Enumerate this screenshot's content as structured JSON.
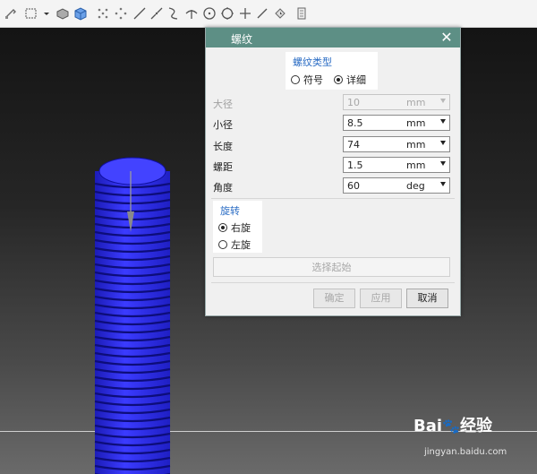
{
  "toolbar": {
    "icons": [
      "wrench-icon",
      "select-box-icon",
      "dropdown-arrow-icon",
      "solid-icon",
      "cube-icon",
      "snap-icon",
      "points-icon",
      "line-icon",
      "curve-icon",
      "spline-icon",
      "normal-icon",
      "circle-icon",
      "gear-point-icon",
      "cross-icon",
      "diagonal-icon",
      "cursor-icon",
      "panel-icon"
    ]
  },
  "dialog": {
    "title": "螺纹",
    "close_icon": "close-icon",
    "thread_type": {
      "title": "螺纹类型",
      "options": [
        {
          "label": "符号",
          "selected": false
        },
        {
          "label": "详细",
          "selected": true
        }
      ]
    },
    "fields": [
      {
        "label": "大径",
        "value": "10",
        "unit": "mm",
        "disabled": true
      },
      {
        "label": "小径",
        "value": "8.5",
        "unit": "mm",
        "disabled": false
      },
      {
        "label": "长度",
        "value": "74",
        "unit": "mm",
        "disabled": false
      },
      {
        "label": "螺距",
        "value": "1.5",
        "unit": "mm",
        "disabled": false
      },
      {
        "label": "角度",
        "value": "60",
        "unit": "deg",
        "disabled": false
      }
    ],
    "rotation": {
      "title": "旋转",
      "options": [
        {
          "label": "右旋",
          "selected": true
        },
        {
          "label": "左旋",
          "selected": false
        }
      ]
    },
    "select_start_label": "选择起始",
    "buttons": {
      "ok": "确定",
      "apply": "应用",
      "cancel": "取消"
    }
  },
  "watermark": {
    "brand": "Bai",
    "brand2": "经验",
    "url": "jingyan.baidu.com"
  },
  "colors": {
    "titlebar": "#5d8f85",
    "thread": "#2a2ae6",
    "group_title": "#2a6cc4"
  }
}
